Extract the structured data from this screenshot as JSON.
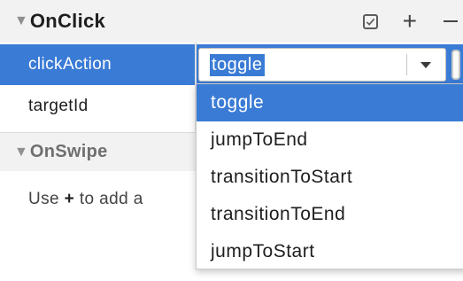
{
  "sections": {
    "onclick": {
      "title": "OnClick",
      "caret": "▼"
    },
    "onswipe": {
      "title": "OnSwipe",
      "caret": "▼"
    }
  },
  "toolbar": {
    "add_symbol": "+"
  },
  "rows": [
    {
      "label": "clickAction"
    },
    {
      "label": "targetId"
    }
  ],
  "combo": {
    "value": "toggle"
  },
  "hint": {
    "prefix": "Use ",
    "symbol": "+",
    "suffix": " to add a"
  },
  "dropdown": {
    "options": [
      "toggle",
      "jumpToEnd",
      "transitionToStart",
      "transitionToEnd",
      "jumpToStart"
    ],
    "selected": "toggle"
  },
  "colors": {
    "accent": "#3a7bd5",
    "header_bg": "#f2f2f2"
  },
  "icons": [
    "checkbox-icon",
    "plus-icon",
    "minus-icon",
    "chevron-down-icon",
    "caret-down-icon"
  ]
}
